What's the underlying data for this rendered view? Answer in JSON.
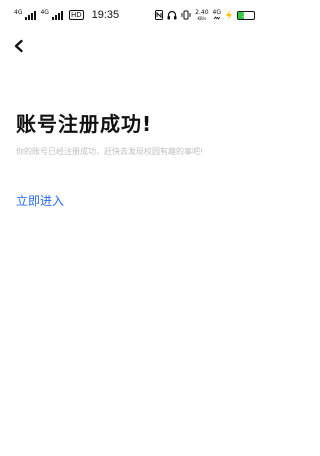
{
  "status_bar": {
    "sim1_label": "4G",
    "sim2_label": "4G",
    "hd_label": "HD",
    "time": "19:35",
    "nfc_icon": "nfc-icon",
    "headset_icon": "headset-icon",
    "vibrate_icon": "vibrate-icon",
    "net_speed_value": "2.40",
    "net_speed_unit": "KB/s",
    "wifi_label": "4G",
    "battery_level": "35",
    "battery_color": "#2ecc40"
  },
  "nav": {
    "back_icon": "chevron-left-icon"
  },
  "main": {
    "title": "账号注册成功!",
    "subtitle": "你的账号已经注册成功，赶快去发现校园有趣的事吧!",
    "enter_label": "立即进入",
    "accent_color": "#2a6cff"
  }
}
